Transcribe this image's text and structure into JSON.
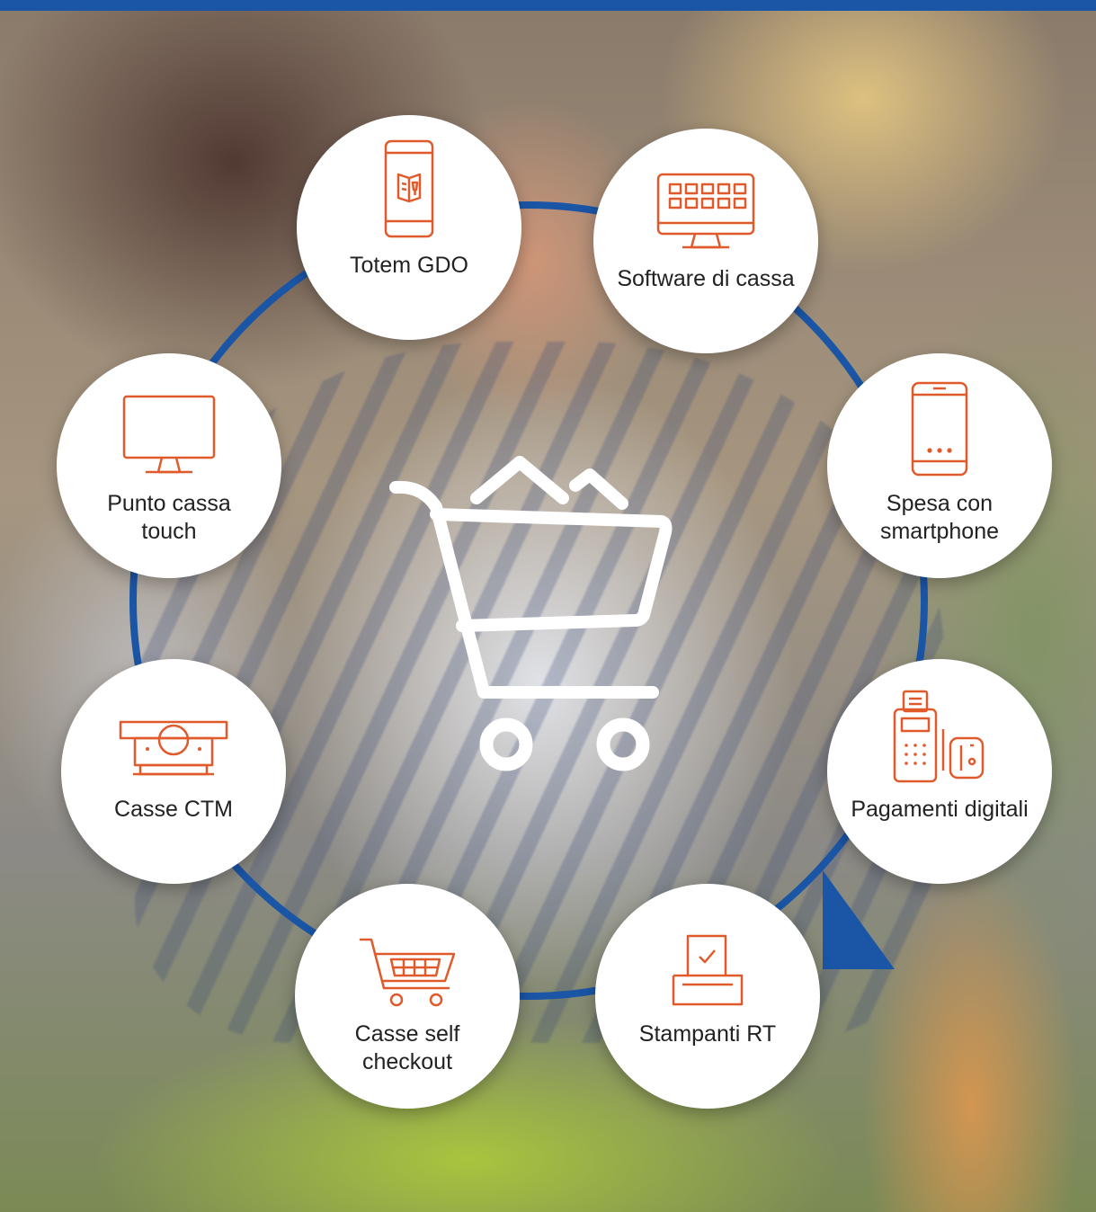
{
  "colors": {
    "accent": "#e05a2b",
    "ring": "#1a55a6",
    "circle": "#ffffff",
    "text": "#222222"
  },
  "center_icon": "shopping-cart-icon",
  "nodes": [
    {
      "label": "Totem GDO",
      "icon": "kiosk-totem-icon"
    },
    {
      "label": "Software di cassa",
      "icon": "monitor-software-icon"
    },
    {
      "label": "Spesa con smartphone",
      "icon": "smartphone-icon"
    },
    {
      "label": "Pagamenti digitali",
      "icon": "payment-terminal-icon"
    },
    {
      "label": "Stampanti RT",
      "icon": "receipt-printer-icon"
    },
    {
      "label": "Casse self checkout",
      "icon": "cart-icon"
    },
    {
      "label": "Casse CTM",
      "icon": "cash-machine-icon"
    },
    {
      "label": "Punto cassa touch",
      "icon": "touch-monitor-icon"
    }
  ]
}
